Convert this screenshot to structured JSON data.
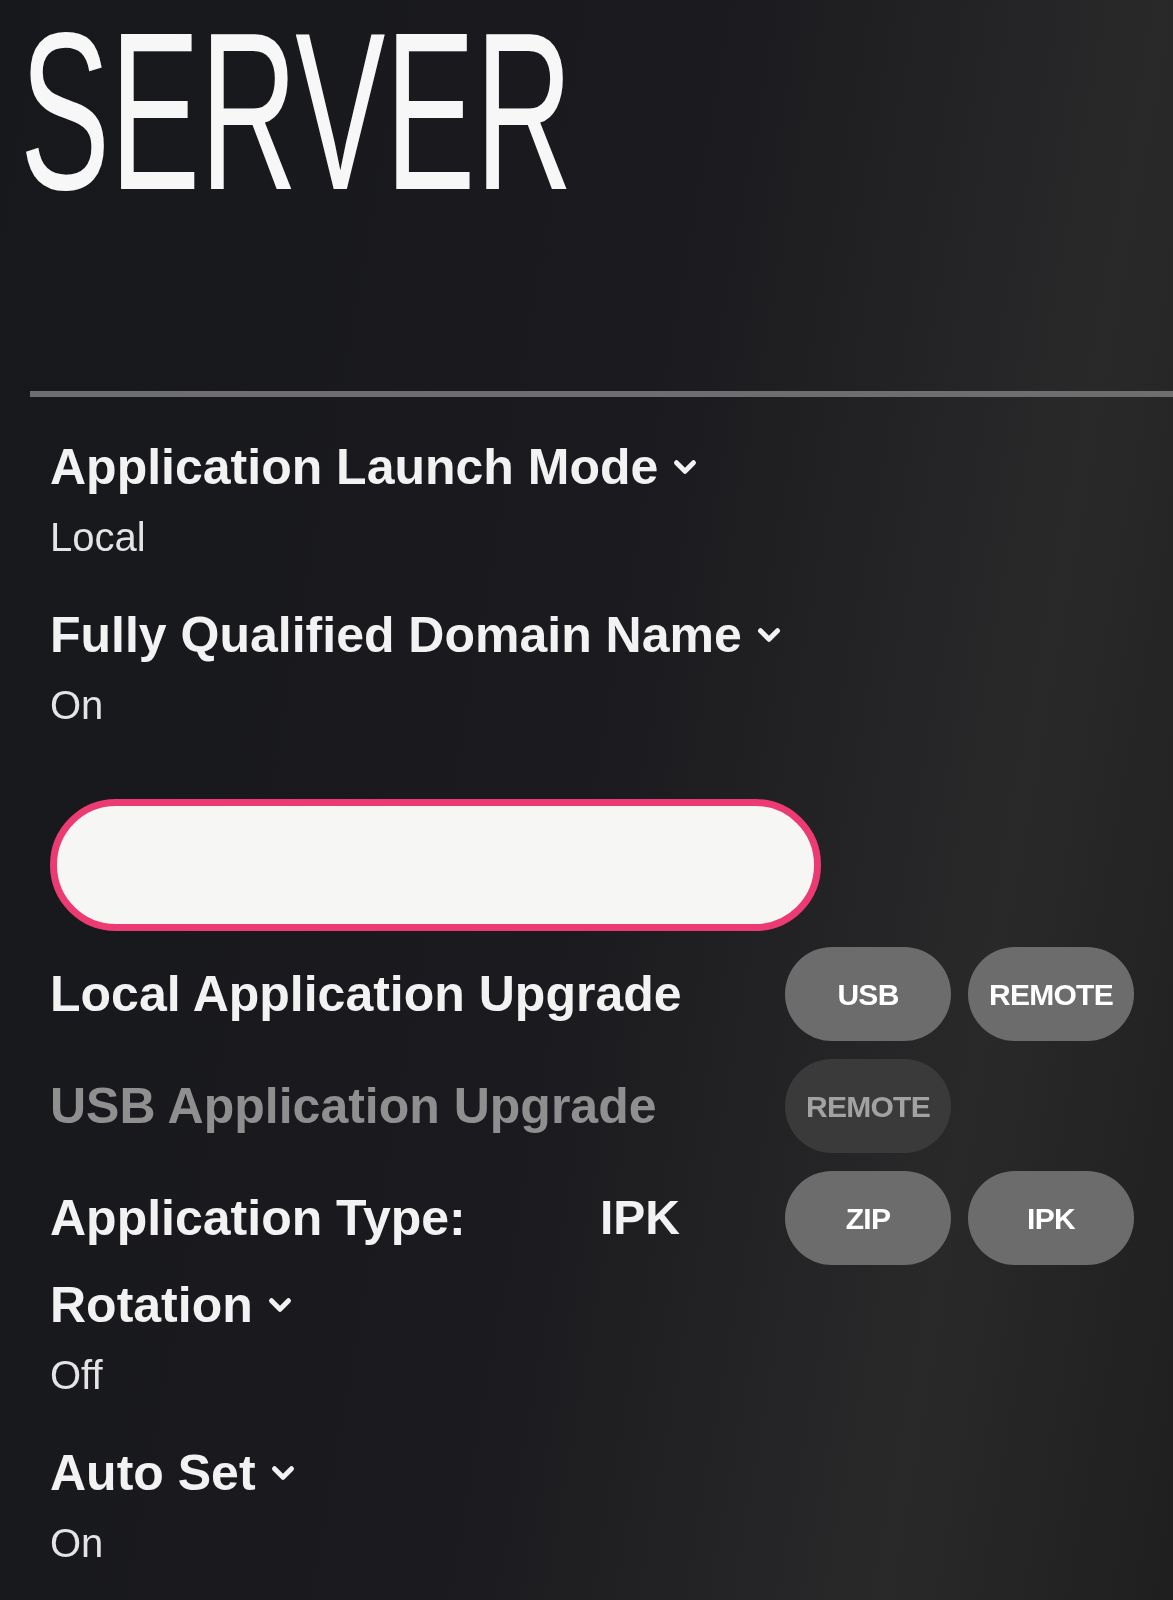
{
  "title": "SERVER",
  "settings": [
    {
      "kind": "dropdown",
      "label": "Application Launch Mode",
      "value": "Local"
    },
    {
      "kind": "dropdown",
      "label": "Fully Qualified Domain Name",
      "value": "On"
    },
    {
      "kind": "text_field",
      "focused": true
    },
    {
      "kind": "buttons",
      "label": "Local Application Upgrade",
      "disabled": false,
      "buttons": [
        "USB",
        "REMOTE"
      ]
    },
    {
      "kind": "buttons",
      "label": "USB Application Upgrade",
      "disabled": true,
      "buttons": [
        "REMOTE"
      ]
    },
    {
      "kind": "buttons",
      "label": "Application Type:",
      "value": "IPK",
      "disabled": false,
      "buttons": [
        "ZIP",
        "IPK"
      ]
    },
    {
      "kind": "dropdown",
      "label": "Rotation",
      "value": "Off"
    },
    {
      "kind": "dropdown",
      "label": "Auto Set",
      "value": "On"
    }
  ]
}
